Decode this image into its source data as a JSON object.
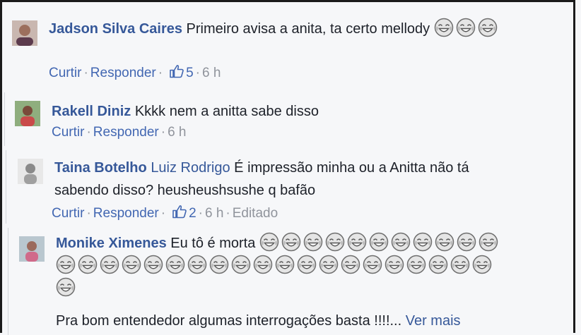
{
  "comments": [
    {
      "author": "Jadson Silva Caires",
      "text": "Primeiro avisa a anita, ta certo mellody",
      "emoji_count": 3,
      "actions": {
        "like": "Curtir",
        "reply": "Responder",
        "likes": "5",
        "time": "6 h"
      }
    },
    {
      "author": "Rakell Diniz",
      "text": "Kkkk nem a anitta sabe disso",
      "actions": {
        "like": "Curtir",
        "reply": "Responder",
        "time": "6 h"
      }
    },
    {
      "author": "Taina Botelho",
      "mention": "Luiz Rodrigo",
      "text_line1": "É impressão minha ou a Anitta não tá",
      "text_line2": "sabendo disso? heusheushsushe q bafão",
      "actions": {
        "like": "Curtir",
        "reply": "Responder",
        "likes": "2",
        "time": "6 h",
        "edited": "Editado"
      }
    },
    {
      "author": "Monike Ximenes",
      "text": "Eu tô é morta",
      "emoji_count": 32,
      "text2": "Pra bom entendedor algumas interrogações basta !!!!...",
      "see_more": "Ver mais"
    }
  ],
  "colors": {
    "author": "#365899",
    "link": "#4267b2",
    "meta": "#90949c",
    "background": "#f6f7f9"
  },
  "icons": {
    "emoji": "tears-of-joy-emoji",
    "like": "thumbs-up-icon"
  }
}
